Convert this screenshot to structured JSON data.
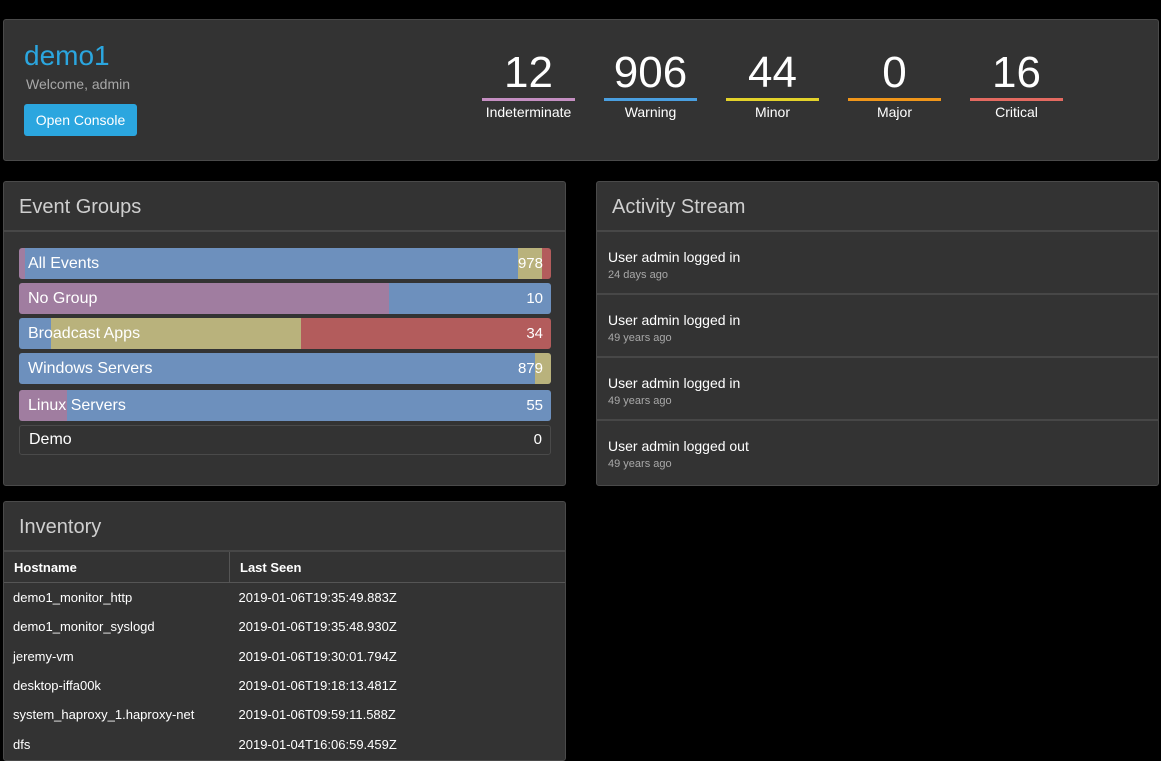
{
  "header": {
    "title": "demo1",
    "welcome": "Welcome, admin",
    "open_console": "Open Console",
    "severities": [
      {
        "label": "Indeterminate",
        "count": "12",
        "color": "#c58fc2"
      },
      {
        "label": "Warning",
        "count": "906",
        "color": "#4a9fe0"
      },
      {
        "label": "Minor",
        "count": "44",
        "color": "#e3d22a"
      },
      {
        "label": "Major",
        "count": "0",
        "color": "#f0961a"
      },
      {
        "label": "Critical",
        "count": "16",
        "color": "#e46a61"
      }
    ]
  },
  "event_groups": {
    "title": "Event Groups",
    "colors": {
      "indeterminate": "#a07da0",
      "warning": "#6d90bd",
      "minor": "#b9b27c",
      "critical": "#b35c5c"
    },
    "items": [
      {
        "name": "All Events",
        "count": "978",
        "shares": {
          "indeterminate": 0.012,
          "warning": 0.926,
          "minor": 0.045,
          "critical": 0.017
        }
      },
      {
        "name": "No Group",
        "count": "10",
        "shares": {
          "indeterminate": 0.695,
          "warning": 0.305,
          "minor": 0,
          "critical": 0
        }
      },
      {
        "name": "Broadcast Apps",
        "count": "34",
        "shares": {
          "indeterminate": 0,
          "warning": 0.06,
          "minor": 0.47,
          "critical": 0.47
        }
      },
      {
        "name": "Windows Servers",
        "count": "879",
        "shares": {
          "indeterminate": 0,
          "warning": 0.97,
          "minor": 0.03,
          "critical": 0
        }
      },
      {
        "name": "Linux Servers",
        "count": "55",
        "shares": {
          "indeterminate": 0.09,
          "warning": 0.91,
          "minor": 0,
          "critical": 0
        }
      },
      {
        "name": "Demo",
        "count": "0",
        "shares": {
          "indeterminate": 0,
          "warning": 0,
          "minor": 0,
          "critical": 0
        }
      }
    ]
  },
  "activity": {
    "title": "Activity Stream",
    "items": [
      {
        "text": "User admin logged in",
        "time": "24 days ago"
      },
      {
        "text": "User admin logged in",
        "time": "49 years ago"
      },
      {
        "text": "User admin logged in",
        "time": "49 years ago"
      },
      {
        "text": "User admin logged out",
        "time": "49 years ago"
      }
    ]
  },
  "inventory": {
    "title": "Inventory",
    "columns": [
      "Hostname",
      "Last Seen"
    ],
    "rows": [
      [
        "demo1_monitor_http",
        "2019-01-06T19:35:49.883Z"
      ],
      [
        "demo1_monitor_syslogd",
        "2019-01-06T19:35:48.930Z"
      ],
      [
        "jeremy-vm",
        "2019-01-06T19:30:01.794Z"
      ],
      [
        "desktop-iffa00k",
        "2019-01-06T19:18:13.481Z"
      ],
      [
        "system_haproxy_1.haproxy-net",
        "2019-01-06T09:59:11.588Z"
      ],
      [
        "dfs",
        "2019-01-04T16:06:59.459Z"
      ]
    ]
  }
}
